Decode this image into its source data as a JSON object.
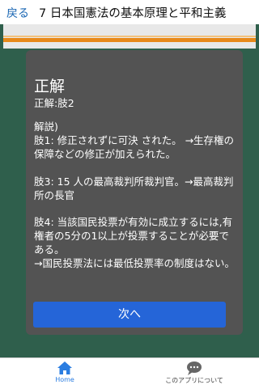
{
  "header": {
    "back_label": "戻る",
    "title": "7 日本国憲法の基本原理と平和主義"
  },
  "answer": {
    "title": "正解",
    "subtitle": "正解:肢2",
    "explanation": "解説)\n肢1: 修正されずに可決 された。 →生存権の保障などの修正が加えられた。\n\n肢3: 15 人の最高裁判所裁判官。→最高裁判所の長官\n\n肢4: 当該国民投票が有効に成立するには,有権者の5分の1以上が投票することが必要である。\n→国民投票法には最低投票率の制度はない。"
  },
  "next_button": {
    "label": "次へ"
  },
  "tabbar": {
    "home_label": "Home",
    "about_label": "このアプリについて"
  },
  "colors": {
    "accent": "#2565d8",
    "background": "#2f5f4c",
    "card": "#535353",
    "bar": "#e8891a"
  }
}
